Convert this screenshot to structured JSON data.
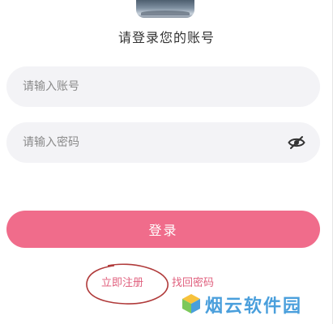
{
  "header": {
    "avatar_icon": "app-logo-image",
    "subtitle": "请登录您的账号"
  },
  "form": {
    "account_placeholder": "请输入账号",
    "account_value": "",
    "password_placeholder": "请输入密码",
    "password_value": "",
    "visibility_icon": "eye-off-icon",
    "login_label": "登录"
  },
  "links": {
    "register": "立即注册",
    "recover": "找回密码"
  },
  "watermark": {
    "text": "烟云软件园",
    "icon": "cube-logo-icon"
  },
  "colors": {
    "accent": "#f06c8b",
    "link": "#e0607e",
    "field_bg": "#f3f3f6",
    "watermark": "#4a9fdc",
    "annotation": "#b03a3a"
  }
}
